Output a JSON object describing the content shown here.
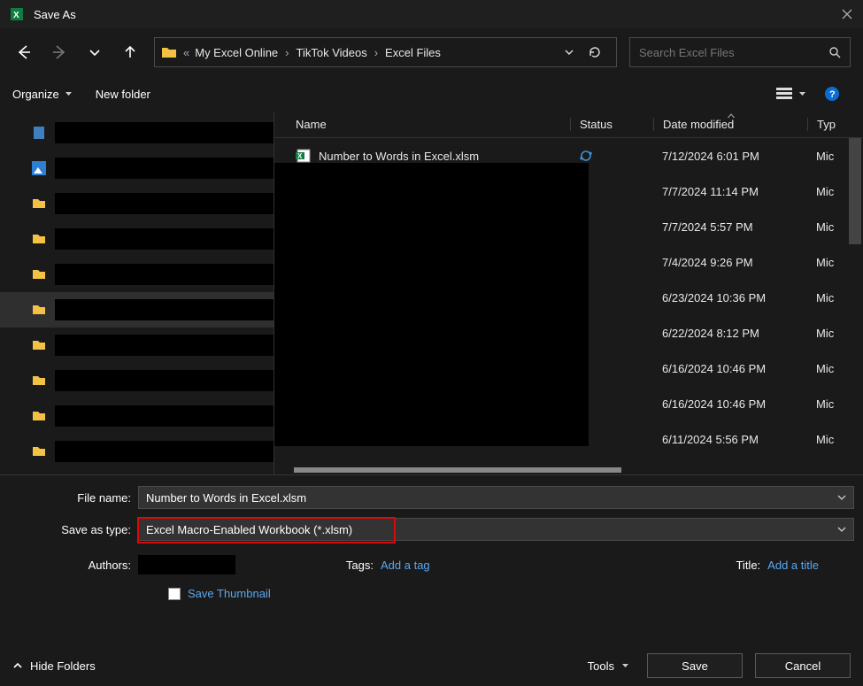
{
  "window": {
    "title": "Save As"
  },
  "breadcrumb": {
    "parts": [
      "My Excel Online",
      "TikTok Videos",
      "Excel Files"
    ]
  },
  "search": {
    "placeholder": "Search Excel Files"
  },
  "toolbar": {
    "organize_label": "Organize",
    "newfolder_label": "New folder"
  },
  "columns": {
    "name": "Name",
    "status": "Status",
    "date": "Date modified",
    "type": "Typ"
  },
  "files": [
    {
      "name": "Number to Words in Excel.xlsm",
      "status": "sync",
      "date": "7/12/2024 6:01 PM",
      "type": "Mic"
    },
    {
      "name": "",
      "status": "",
      "date": "7/7/2024 11:14 PM",
      "type": "Mic"
    },
    {
      "name": "",
      "status": "",
      "date": "7/7/2024 5:57 PM",
      "type": "Mic"
    },
    {
      "name": "",
      "status": "",
      "date": "7/4/2024 9:26 PM",
      "type": "Mic"
    },
    {
      "name": "",
      "status": "",
      "date": "6/23/2024 10:36 PM",
      "type": "Mic"
    },
    {
      "name": "",
      "status": "",
      "date": "6/22/2024 8:12 PM",
      "type": "Mic"
    },
    {
      "name": "",
      "status": "",
      "date": "6/16/2024 10:46 PM",
      "type": "Mic"
    },
    {
      "name": "",
      "status": "",
      "date": "6/16/2024 10:46 PM",
      "type": "Mic"
    },
    {
      "name": "",
      "status": "",
      "date": "6/11/2024 5:56 PM",
      "type": "Mic"
    }
  ],
  "form": {
    "filename_label": "File name:",
    "filename_value": "Number to Words in Excel.xlsm",
    "saveastype_label": "Save as type:",
    "saveastype_value": "Excel Macro-Enabled Workbook (*.xlsm)",
    "authors_label": "Authors:",
    "tags_label": "Tags:",
    "tags_hint": "Add a tag",
    "title_label": "Title:",
    "title_hint": "Add a title",
    "thumb_label": "Save Thumbnail"
  },
  "bottom": {
    "hide_label": "Hide Folders",
    "tools_label": "Tools",
    "save_label": "Save",
    "cancel_label": "Cancel"
  }
}
